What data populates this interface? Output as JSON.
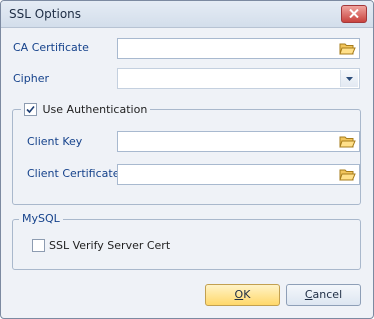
{
  "dialog": {
    "title": "SSL Options"
  },
  "fields": {
    "ca_certificate": {
      "label": "CA Certificate",
      "value": ""
    },
    "cipher": {
      "label": "Cipher",
      "value": ""
    },
    "client_key": {
      "label": "Client Key",
      "value": ""
    },
    "client_certificate": {
      "label": "Client Certificate",
      "value": ""
    }
  },
  "authentication": {
    "label": "Use Authentication",
    "checked": true
  },
  "mysql": {
    "group_title": "MySQL",
    "verify_server_cert": {
      "label": "SSL Verify Server Cert",
      "checked": false
    }
  },
  "buttons": {
    "ok": {
      "accel": "O",
      "rest": "K"
    },
    "cancel": {
      "accel": "C",
      "rest": "ancel"
    }
  },
  "icons": {
    "close": "close-icon",
    "folder": "folder-open-icon",
    "dropdown": "chevron-down-icon"
  },
  "colors": {
    "label_blue": "#15428b",
    "ok_button": "#ffd86b",
    "close_button": "#c8433e"
  }
}
